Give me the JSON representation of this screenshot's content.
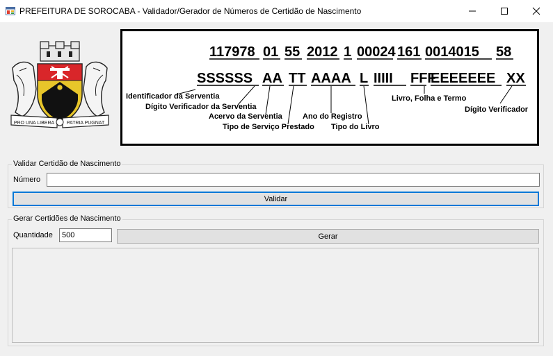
{
  "window": {
    "title": "PREFEITURA DE SOROCABA - Validador/Gerador de Números de Certidão de Nascimento",
    "icon": "app-window-icon",
    "controls": [
      "minimize-icon",
      "maximize-icon",
      "close-icon"
    ]
  },
  "crest": {
    "motto_left": "PRO UNA LIBERA",
    "motto_right": "PATRIA PUGNAT"
  },
  "diagram": {
    "example_number": [
      "117978",
      "01",
      "55",
      "2012",
      "1",
      "00024",
      "161",
      "0014015",
      "58"
    ],
    "pattern": [
      "SSSSSS",
      "AA",
      "TT",
      "AAAA",
      "L",
      "IIIII",
      "FFF",
      "EEEEEEE",
      "XX"
    ],
    "labels": {
      "serventia": "Identificador da Serventia",
      "digito_serventia": "Dígito Verificador da Serventia",
      "acervo": "Acervo da Serventia",
      "tipo_servico": "Tipo de Serviço Prestado",
      "ano": "Ano do Registro",
      "tipo_livro": "Tipo do Livro",
      "livro": "Livro, Folha e Termo",
      "digito": "Dígito Verificador"
    }
  },
  "validate": {
    "legend": "Validar Certidão de Nascimento",
    "number_label": "Número",
    "number_value": "",
    "button": "Validar"
  },
  "generate": {
    "legend": "Gerar Certidões de Nascimento",
    "quantity_label": "Quantidade",
    "quantity_value": "500",
    "button": "Gerar",
    "output": ""
  }
}
